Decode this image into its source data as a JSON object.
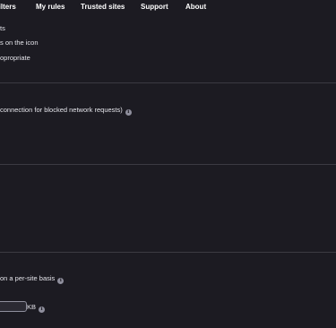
{
  "tabs": {
    "filters": "filters",
    "my_rules": "My rules",
    "trusted_sites": "Trusted sites",
    "support": "Support",
    "about": "About"
  },
  "section1": {
    "line1": "ts",
    "line2": "s on the icon",
    "line3": "opropriate"
  },
  "section2": {
    "line1": " connection for blocked network requests)"
  },
  "section4": {
    "line1": "on a per-site basis",
    "size_value": "",
    "unit": "KB"
  },
  "icons": {
    "info": "i"
  },
  "colors": {
    "background": "#1c1b22",
    "divider": "#3b3a42",
    "text": "#e4e4ea",
    "info_icon": "#8f8f9d"
  }
}
